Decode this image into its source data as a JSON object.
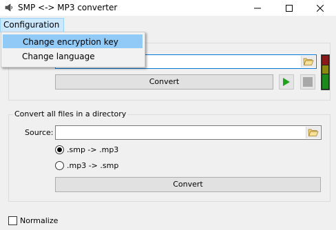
{
  "window": {
    "title": "SMP <-> MP3 converter"
  },
  "menu": {
    "configuration_label": "Configuration",
    "dropdown": [
      {
        "label": "Change encryption key",
        "highlighted": true
      },
      {
        "label": "Change language",
        "highlighted": false
      }
    ]
  },
  "single_file": {
    "file_value": "",
    "convert_label": "Convert",
    "icons": {
      "play": "play-icon",
      "stop": "stop-icon",
      "folder": "folder-open-icon"
    }
  },
  "directory": {
    "group_title": "Convert all files in a directory",
    "source_label": "Source:",
    "source_value": "",
    "options": [
      {
        "label": ".smp -> .mp3",
        "checked": true
      },
      {
        "label": ".mp3 -> .smp",
        "checked": false
      }
    ],
    "convert_label": "Convert"
  },
  "normalize": {
    "label": "Normalize",
    "checked": false
  },
  "colors": {
    "play_green": "#1fa31f",
    "menu_highlight": "#91c9f7",
    "focus_border": "#0078d7"
  }
}
